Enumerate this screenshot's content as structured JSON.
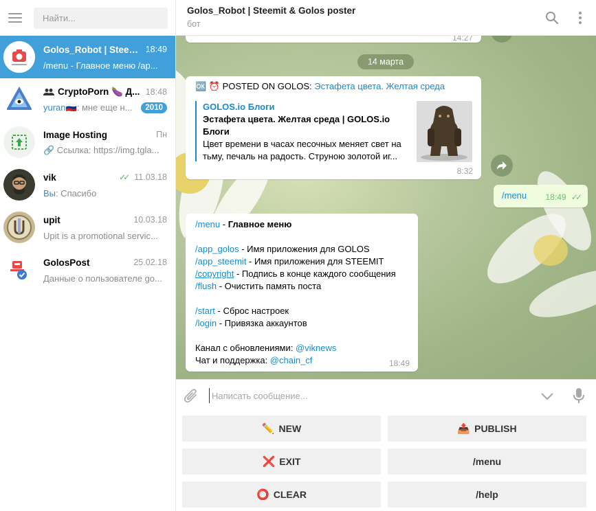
{
  "sidebar": {
    "search_placeholder": "Найти...",
    "chats": [
      {
        "name": "Golos_Robot | Steem...",
        "time": "18:49",
        "preview": "/menu - Главное меню  /ap..."
      },
      {
        "name": "CryptoPorn 🍆 Д...",
        "time": "18:48",
        "sender": "yuran🇷🇺",
        "preview": ": мне еще н...",
        "badge": "2010"
      },
      {
        "name": "Image Hosting",
        "time": "Пн",
        "preview": "🔗 Ссылка: https://img.tgla..."
      },
      {
        "name": "vik",
        "time": "11.03.18",
        "sender": "Вы",
        "preview": ": Спасибо",
        "read": true
      },
      {
        "name": "upit",
        "time": "10.03.18",
        "preview": "Upit is a promotional servic..."
      },
      {
        "name": "GolosPost",
        "time": "25.02.18",
        "preview": "Данные о пользователе go..."
      }
    ]
  },
  "header": {
    "title": "Golos_Robot | Steemit & Golos poster",
    "subtitle": "бот"
  },
  "messages": {
    "prev_time": "14:27",
    "date_label": "14 марта",
    "post": {
      "prefix": "🆗 ⏰ POSTED ON GOLOS:",
      "link_text": "Эстафета цвета. Желтая среда",
      "preview_site": "GOLOS.io Блоги",
      "preview_title_1": "Эстафета цвета. Желтая среда | GOLOS.io",
      "preview_title_2": "Блоги",
      "preview_desc_1": "Цвет времени в часах песочных меняет свет на",
      "preview_desc_2": "тьму, печаль на радость. Струною золотой иг...",
      "time": "8:32"
    },
    "outgoing": {
      "text": "/menu",
      "time": "18:49"
    },
    "menu": {
      "line1_cmd": "/menu",
      "line1_text": " - ",
      "line1_bold": "Главное меню",
      "app_golos_cmd": "/app_golos",
      "app_golos_text": " - Имя приложения для GOLOS",
      "app_steemit_cmd": "/app_steemit",
      "app_steemit_text": " - Имя приложения для STEEMIT",
      "copyright_cmd": "/copyright",
      "copyright_text": " - Подпись в конце каждого сообщения",
      "flush_cmd": "/flush",
      "flush_text": " - Очистить память поста",
      "start_cmd": "/start",
      "start_text": " - Сброс настроек",
      "login_cmd": "/login",
      "login_text": " - Привязка аккаунтов",
      "channel_text": "Канал с обновлениями: ",
      "channel_link": "@viknews",
      "support_text": "Чат и поддержка: ",
      "support_link": "@chain_cf",
      "time": "18:49"
    }
  },
  "composer": {
    "placeholder": "Написать сообщение..."
  },
  "keyboard": {
    "new": {
      "emoji": "✏️",
      "label": "NEW"
    },
    "publish": {
      "emoji": "📤",
      "label": "PUBLISH"
    },
    "exit": {
      "emoji": "❌",
      "label": "EXIT"
    },
    "menu": {
      "label": "/menu"
    },
    "clear": {
      "emoji": "⭕",
      "label": "CLEAR"
    },
    "help": {
      "label": "/help"
    }
  }
}
